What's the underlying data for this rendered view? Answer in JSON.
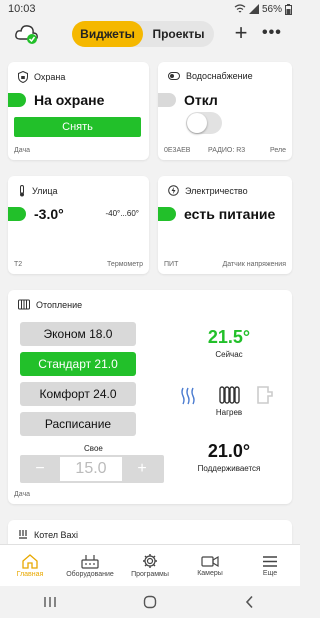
{
  "status": {
    "time": "10:03",
    "battery": "56%"
  },
  "tabs": {
    "widgets": "Виджеты",
    "projects": "Проекты"
  },
  "security": {
    "title": "Охрана",
    "state": "На охране",
    "button": "Снять",
    "footer": "Дача"
  },
  "water": {
    "title": "Водоснабжение",
    "state": "Откл",
    "foot_left": "0E3AEB",
    "foot_mid": "РАДИО: R3",
    "foot_right": "Реле"
  },
  "street": {
    "title": "Улица",
    "value": "-3.0°",
    "range": "-40°...60°",
    "foot_left": "T2",
    "foot_right": "Термометр"
  },
  "power": {
    "title": "Электричество",
    "state": "есть питание",
    "foot_left": "ПИТ",
    "foot_right": "Датчик напряжения"
  },
  "heating": {
    "title": "Отопление",
    "modes": [
      "Эконом 18.0",
      "Стандарт 21.0",
      "Комфорт 24.0",
      "Расписание"
    ],
    "active_mode": 1,
    "current_temp": "21.5°",
    "current_label": "Сейчас",
    "heat_label": "Нагрев",
    "own_label": "Свое",
    "stepper_value": "15.0",
    "stepper_minus": "−",
    "stepper_plus": "+",
    "target_temp": "21.0°",
    "target_label": "Поддерживается",
    "footer": "Дача"
  },
  "boiler": {
    "title": "Котел Baxi"
  },
  "nav": {
    "home": "Главная",
    "equipment": "Оборудование",
    "programs": "Программы",
    "cameras": "Камеры",
    "more": "Еще"
  },
  "colors": {
    "accent": "#f5b800",
    "green": "#22c02a"
  }
}
